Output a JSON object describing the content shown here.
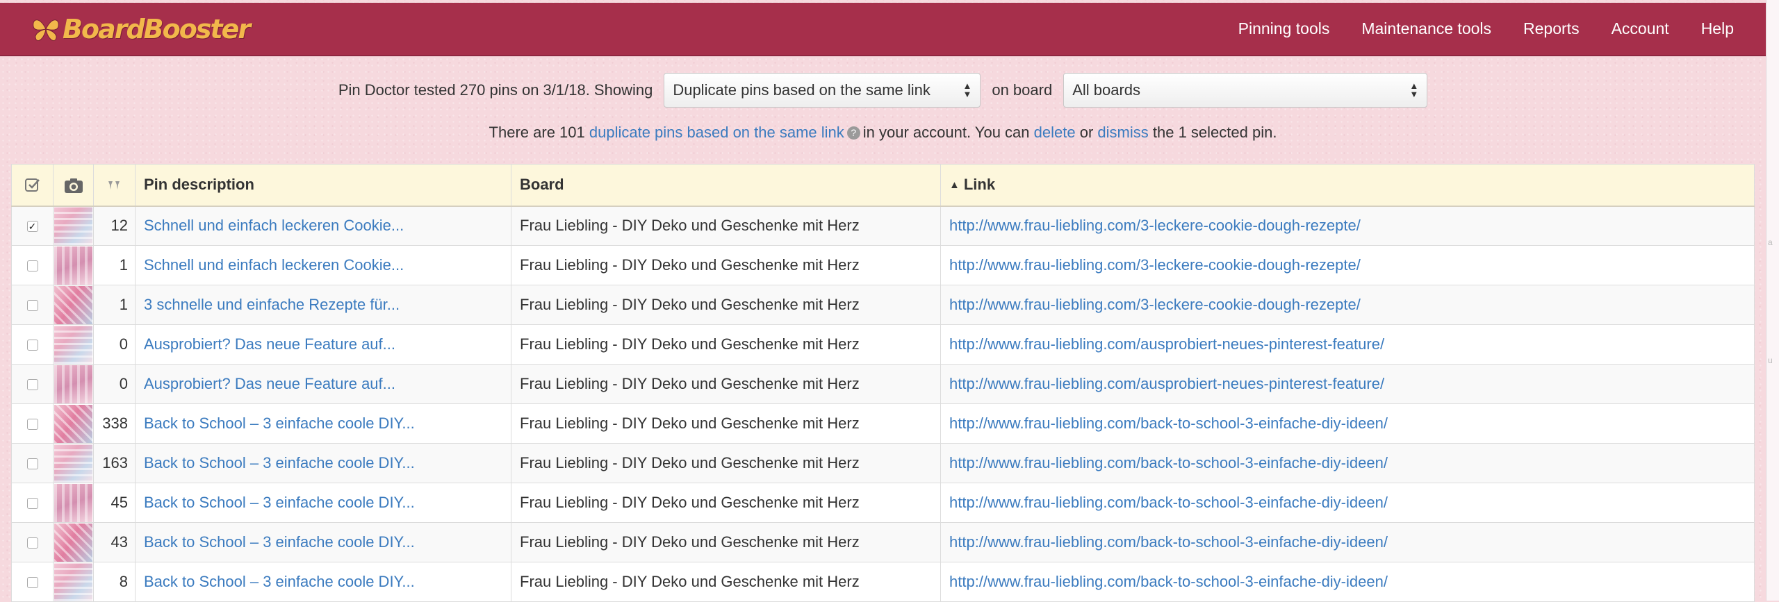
{
  "brand": {
    "name": "BoardBooster"
  },
  "nav": {
    "items": [
      {
        "label": "Pinning tools"
      },
      {
        "label": "Maintenance tools"
      },
      {
        "label": "Reports"
      },
      {
        "label": "Account"
      },
      {
        "label": "Help"
      }
    ]
  },
  "filter": {
    "prefix": "Pin Doctor tested 270 pins on 3/1/18. Showing",
    "type_value": "Duplicate pins based on the same link",
    "on_board_label": "on board",
    "board_value": "All boards"
  },
  "info": {
    "part1": "There are 101",
    "link_duplicates": "duplicate pins based on the same link",
    "part2": "in your account.  You can",
    "link_delete": "delete",
    "or": "or",
    "link_dismiss": "dismiss",
    "part3": "the 1 selected pin."
  },
  "table": {
    "headers": {
      "check_icon": "check-circle-icon",
      "camera_icon": "camera-icon",
      "pins_icon": "pins-icon",
      "description": "Pin description",
      "board": "Board",
      "link": "Link",
      "link_sort_icon": "sort-up-icon"
    },
    "rows": [
      {
        "checked": true,
        "count": "12",
        "description": "Schnell und einfach leckeren Cookie...",
        "board": "Frau Liebling - DIY Deko und Geschenke mit Herz",
        "link": "http://www.frau-liebling.com/3-leckere-cookie-dough-rezepte/"
      },
      {
        "checked": false,
        "count": "1",
        "description": "Schnell und einfach leckeren Cookie...",
        "board": "Frau Liebling - DIY Deko und Geschenke mit Herz",
        "link": "http://www.frau-liebling.com/3-leckere-cookie-dough-rezepte/"
      },
      {
        "checked": false,
        "count": "1",
        "description": "3 schnelle und einfache Rezepte für...",
        "board": "Frau Liebling - DIY Deko und Geschenke mit Herz",
        "link": "http://www.frau-liebling.com/3-leckere-cookie-dough-rezepte/"
      },
      {
        "checked": false,
        "count": "0",
        "description": "Ausprobiert? Das neue Feature auf...",
        "board": "Frau Liebling - DIY Deko und Geschenke mit Herz",
        "link": "http://www.frau-liebling.com/ausprobiert-neues-pinterest-feature/"
      },
      {
        "checked": false,
        "count": "0",
        "description": "Ausprobiert? Das neue Feature auf...",
        "board": "Frau Liebling - DIY Deko und Geschenke mit Herz",
        "link": "http://www.frau-liebling.com/ausprobiert-neues-pinterest-feature/"
      },
      {
        "checked": false,
        "count": "338",
        "description": "Back to School – 3 einfache coole DIY...",
        "board": "Frau Liebling - DIY Deko und Geschenke mit Herz",
        "link": "http://www.frau-liebling.com/back-to-school-3-einfache-diy-ideen/"
      },
      {
        "checked": false,
        "count": "163",
        "description": "Back to School – 3 einfache coole DIY...",
        "board": "Frau Liebling - DIY Deko und Geschenke mit Herz",
        "link": "http://www.frau-liebling.com/back-to-school-3-einfache-diy-ideen/"
      },
      {
        "checked": false,
        "count": "45",
        "description": "Back to School – 3 einfache coole DIY...",
        "board": "Frau Liebling - DIY Deko und Geschenke mit Herz",
        "link": "http://www.frau-liebling.com/back-to-school-3-einfache-diy-ideen/"
      },
      {
        "checked": false,
        "count": "43",
        "description": "Back to School – 3 einfache coole DIY...",
        "board": "Frau Liebling - DIY Deko und Geschenke mit Herz",
        "link": "http://www.frau-liebling.com/back-to-school-3-einfache-diy-ideen/"
      },
      {
        "checked": false,
        "count": "8",
        "description": "Back to School – 3 einfache coole DIY...",
        "board": "Frau Liebling - DIY Deko und Geschenke mit Herz",
        "link": "http://www.frau-liebling.com/back-to-school-3-einfache-diy-ideen/"
      }
    ]
  },
  "colors": {
    "navbar": "#a62f4b",
    "logo": "#f2b84b",
    "link": "#3b7bbf",
    "header_bg": "#fdf7dc",
    "page_bg": "#f6d9de"
  }
}
